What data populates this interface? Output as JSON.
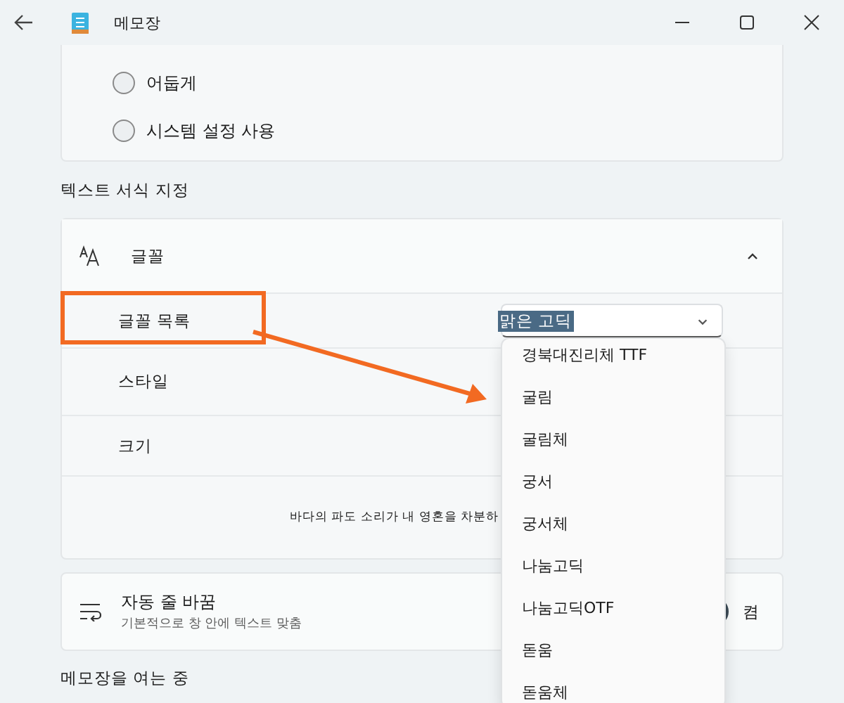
{
  "window": {
    "title": "메모장"
  },
  "theme_options": [
    {
      "label": "어둡게",
      "selected": false
    },
    {
      "label": "시스템 설정 사용",
      "selected": false
    }
  ],
  "section_heading": "텍스트 서식 지정",
  "font_card": {
    "title": "글꼴",
    "expanded": true,
    "rows": [
      {
        "label": "글꼴 목록",
        "kind": "dropdown",
        "value": "맑은 고딕",
        "highlighted": true
      },
      {
        "label": "스타일",
        "kind": "plain",
        "highlighted": false
      },
      {
        "label": "크기",
        "kind": "plain",
        "highlighted": false
      }
    ],
    "preview": "바다의 파도 소리가 내 영혼을 차분하"
  },
  "word_wrap": {
    "title": "자동 줄 바꿈",
    "description": "기본적으로 창 안에 텍스트 맞춤",
    "on": true,
    "state_label": "켬"
  },
  "next_heading": "메모장을 여는 중",
  "dropdown_list": [
    {
      "label": "경북대진리체 TTF"
    },
    {
      "label": "굴림"
    },
    {
      "label": "굴림체"
    },
    {
      "label": "궁서"
    },
    {
      "label": "궁서체"
    },
    {
      "label": "나눔고딕"
    },
    {
      "label": "나눔고딕OTF"
    },
    {
      "label": "돋움"
    },
    {
      "label": "돋움체"
    }
  ]
}
